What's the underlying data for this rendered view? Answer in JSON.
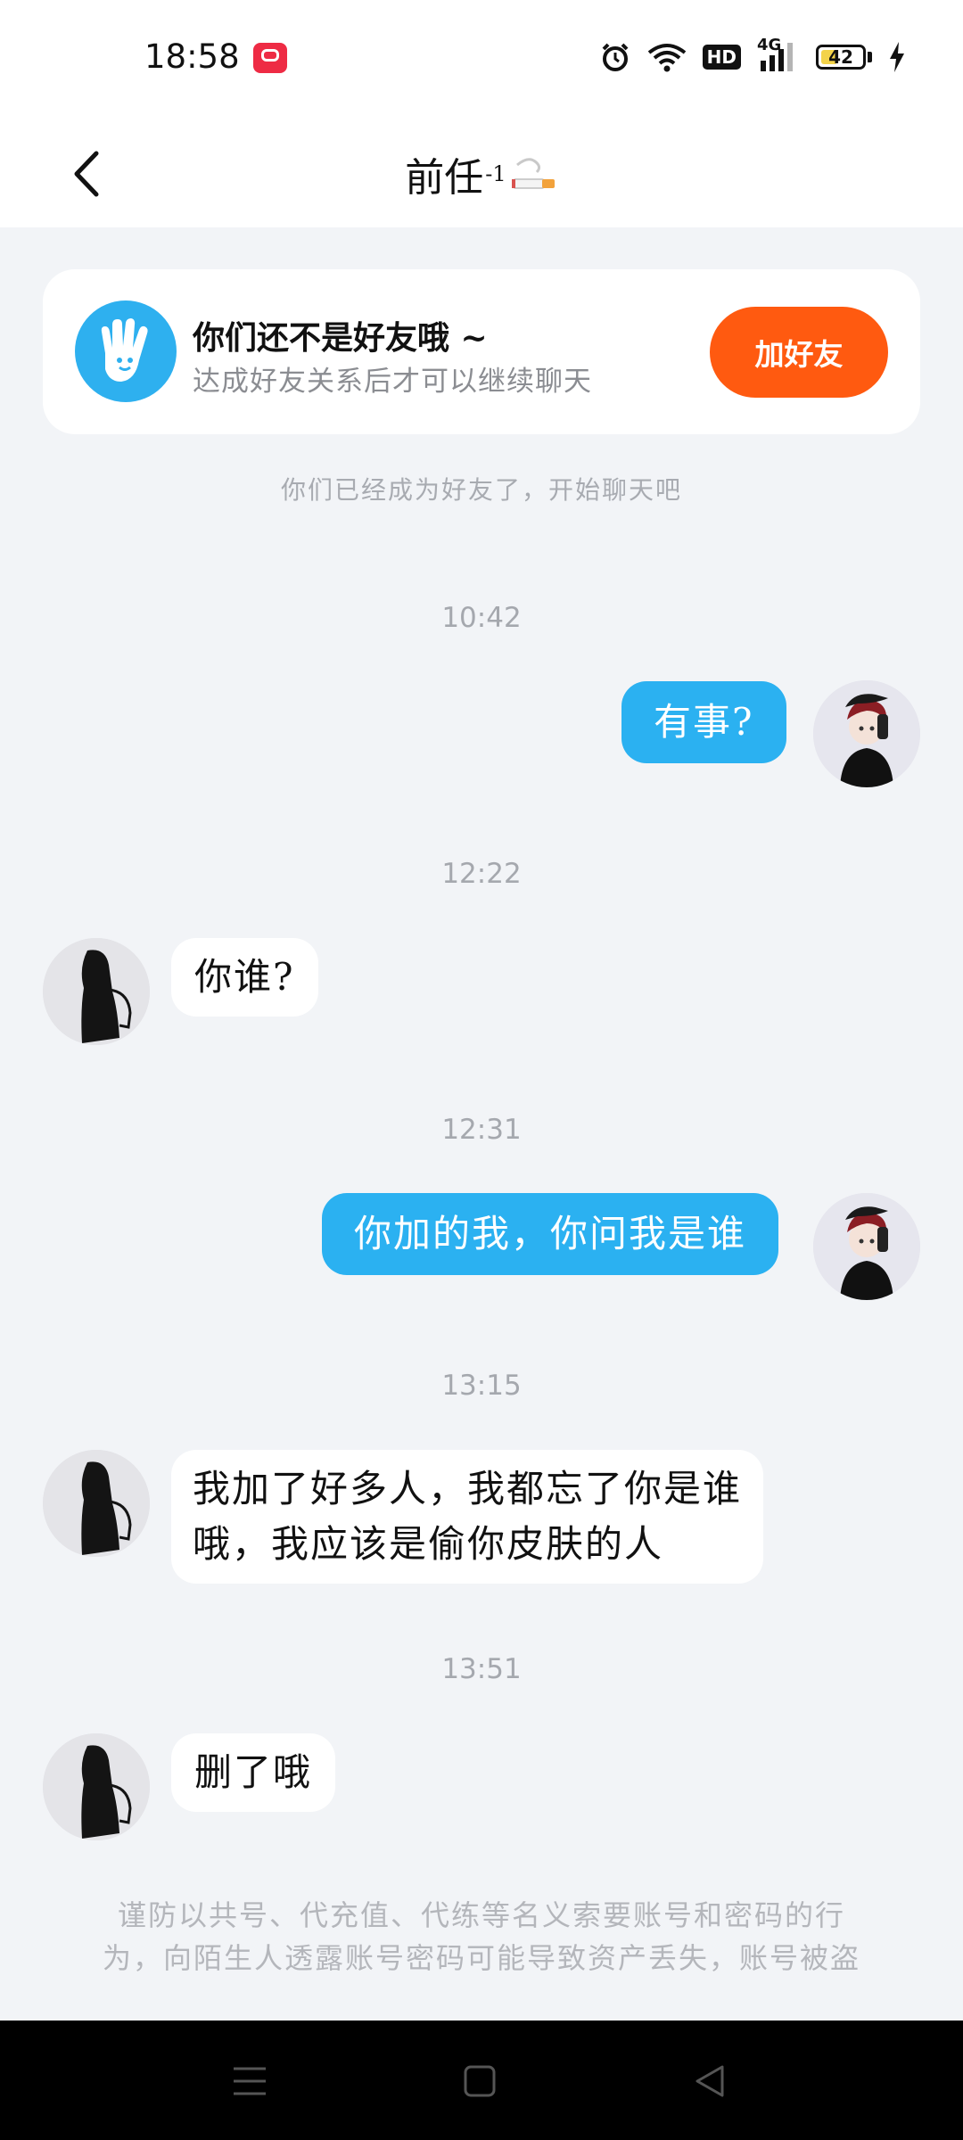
{
  "status_bar": {
    "time": "18:58",
    "hd_label": "HD",
    "network_label": "4G",
    "battery_level": "42",
    "battery_fraction": 0.42,
    "icons": [
      "app-notification-icon",
      "alarm-icon",
      "wifi-icon",
      "hd-icon",
      "signal-icon",
      "battery-icon",
      "charging-icon"
    ]
  },
  "header": {
    "title": "前任",
    "title_superscript": "-1",
    "back_icon": "chevron-left-icon",
    "title_emoji": "cigarette-icon"
  },
  "friend_banner": {
    "title": "你们还不是好友哦 ~",
    "subtitle": "达成好友关系后才可以继续聊天",
    "button": "加好友",
    "accent": "#ff5a10",
    "avatar_icon": "hand-wave-icon"
  },
  "system_note": "你们已经成为好友了，开始聊天吧",
  "messages": [
    {
      "time": "10:42",
      "direction": "out",
      "text": "有事?"
    },
    {
      "time": "12:22",
      "direction": "in",
      "text": "你谁?"
    },
    {
      "time": "12:31",
      "direction": "out",
      "text": "你加的我，你问我是谁"
    },
    {
      "time": "13:15",
      "direction": "in",
      "line1": "我加了好多人，我都忘了你是谁",
      "line2": "哦，我应该是偷你皮肤的人"
    },
    {
      "time": "13:51",
      "direction": "in",
      "text": "删了哦"
    }
  ],
  "safety_notice": {
    "line1": "谨防以共号、代充值、代练等名义索要账号和密码的行",
    "line2": "为，向陌生人透露账号密码可能导致资产丢失，账号被盗"
  },
  "colors": {
    "outgoing_bubble": "#2bb1f1",
    "incoming_bubble": "#ffffff",
    "background": "#f2f4f7"
  },
  "nav_bar": {
    "icons": [
      "menu-icon",
      "home-icon",
      "back-icon"
    ]
  }
}
